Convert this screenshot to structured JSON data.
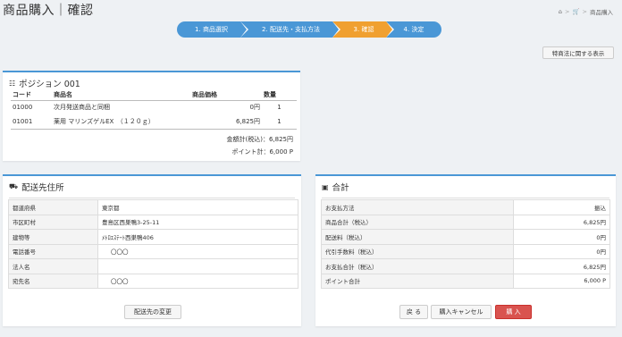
{
  "page_title": "商品購入｜確認",
  "breadcrumb": {
    "current": "商品購入"
  },
  "steps": [
    {
      "label": "1. 商品選択",
      "state": "done"
    },
    {
      "label": "2. 配送先・支払方法",
      "state": "done"
    },
    {
      "label": "3. 確認",
      "state": "current"
    },
    {
      "label": "4. 決定",
      "state": "todo"
    }
  ],
  "tokusho_button": "特商法に関する表示",
  "position_panel": {
    "title": "ポジション 001",
    "headers": {
      "code": "コード",
      "name": "商品名",
      "price": "商品価格",
      "qty": "数量"
    },
    "rows": [
      {
        "code": "01000",
        "name": "次月発送商品と同梱",
        "price": "0円",
        "qty": "1"
      },
      {
        "code": "01001",
        "name": "薬用 マリンズゲルEX　（１２０ｇ）",
        "price": "6,825円",
        "qty": "1"
      }
    ],
    "total_amount": "金額計(税込)：6,825円",
    "total_points": "ポイント計：6,000 P"
  },
  "delivery_panel": {
    "title": "配送先住所",
    "rows": [
      {
        "label": "都道府県",
        "value": "東京都"
      },
      {
        "label": "市区町村",
        "value": "豊島区西巣鴨3-25-11"
      },
      {
        "label": "建物等",
        "value": "ﾒﾄﾛｴｽﾃｰﾄ西巣鴨406"
      },
      {
        "label": "電話番号",
        "value": "〇〇〇"
      },
      {
        "label": "法人名",
        "value": ""
      },
      {
        "label": "宛先名",
        "value": "〇〇〇"
      }
    ],
    "change_button": "配送先の変更"
  },
  "summary_panel": {
    "title": "合計",
    "rows": [
      {
        "label": "お支払方法",
        "value": "振込"
      },
      {
        "label": "商品合計（税込）",
        "value": "6,825円"
      },
      {
        "label": "配送料（税込）",
        "value": "0円"
      },
      {
        "label": "代引手数料（税込）",
        "value": "0円"
      },
      {
        "label": "お支払合計（税込）",
        "value": "6,825円"
      },
      {
        "label": "ポイント合計",
        "value": "6,000 P"
      }
    ],
    "back_button": "戻 る",
    "cancel_button": "購入キャンセル",
    "purchase_button": "購 入"
  }
}
